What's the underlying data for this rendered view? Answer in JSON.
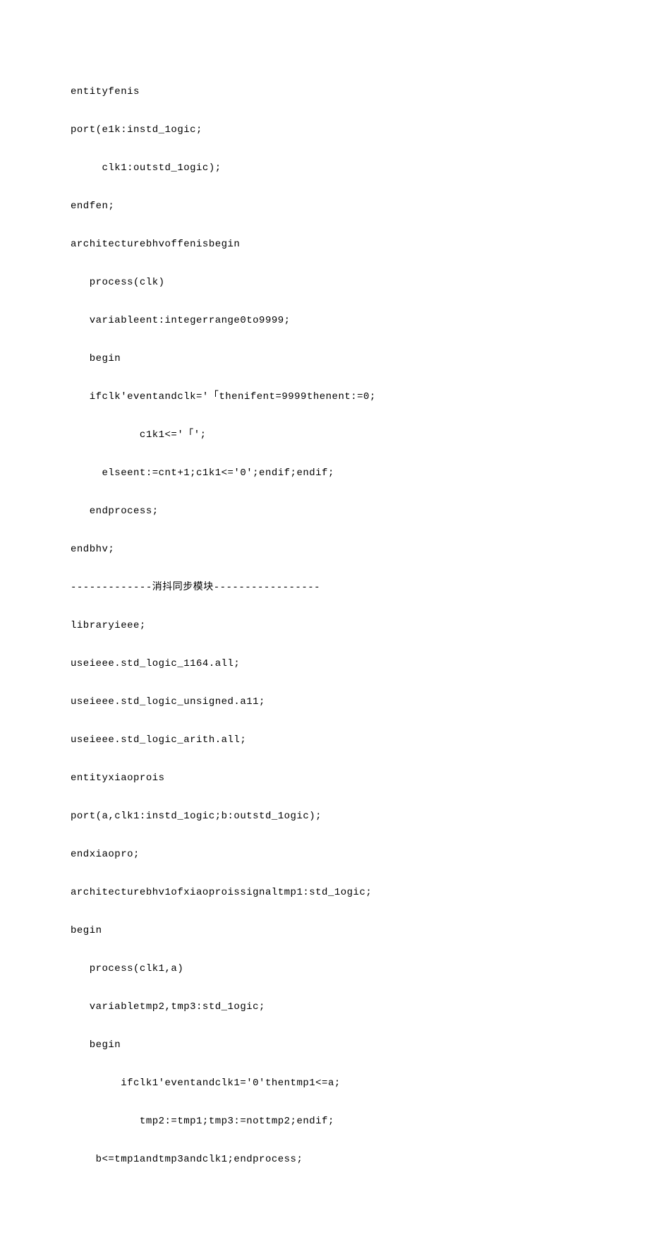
{
  "code": {
    "lines": [
      "entityfenis",
      "port(e1k:instd_1ogic;",
      "     clk1:outstd_1ogic);",
      "endfen;",
      "architecturebhvoffenisbegin",
      "   process(clk)",
      "   variableent:integerrange0to9999;",
      "   begin",
      "   ifclk'eventandclk='「thenifent=9999thenent:=0;",
      "           c1k1<='「';",
      "     elseent:=cnt+1;c1k1<='0';endif;endif;",
      "   endprocess;",
      "endbhv;",
      "-------------消抖同步模块-----------------",
      "libraryieee;",
      "useieee.std_logic_1164.all;",
      "useieee.std_logic_unsigned.a11;",
      "useieee.std_logic_arith.all;",
      "entityxiaoprois",
      "port(a,clk1:instd_1ogic;b:outstd_1ogic);",
      "endxiaopro;",
      "architecturebhv1ofxiaoproissignaltmp1:std_1ogic;",
      "begin",
      "   process(clk1,a)",
      "   variabletmp2,tmp3:std_1ogic;",
      "   begin",
      "        ifclk1'eventandclk1='0'thentmp1<=a;",
      "           tmp2:=tmp1;tmp3:=nottmp2;endif;",
      "    b<=tmp1andtmp3andclk1;endprocess;"
    ]
  }
}
